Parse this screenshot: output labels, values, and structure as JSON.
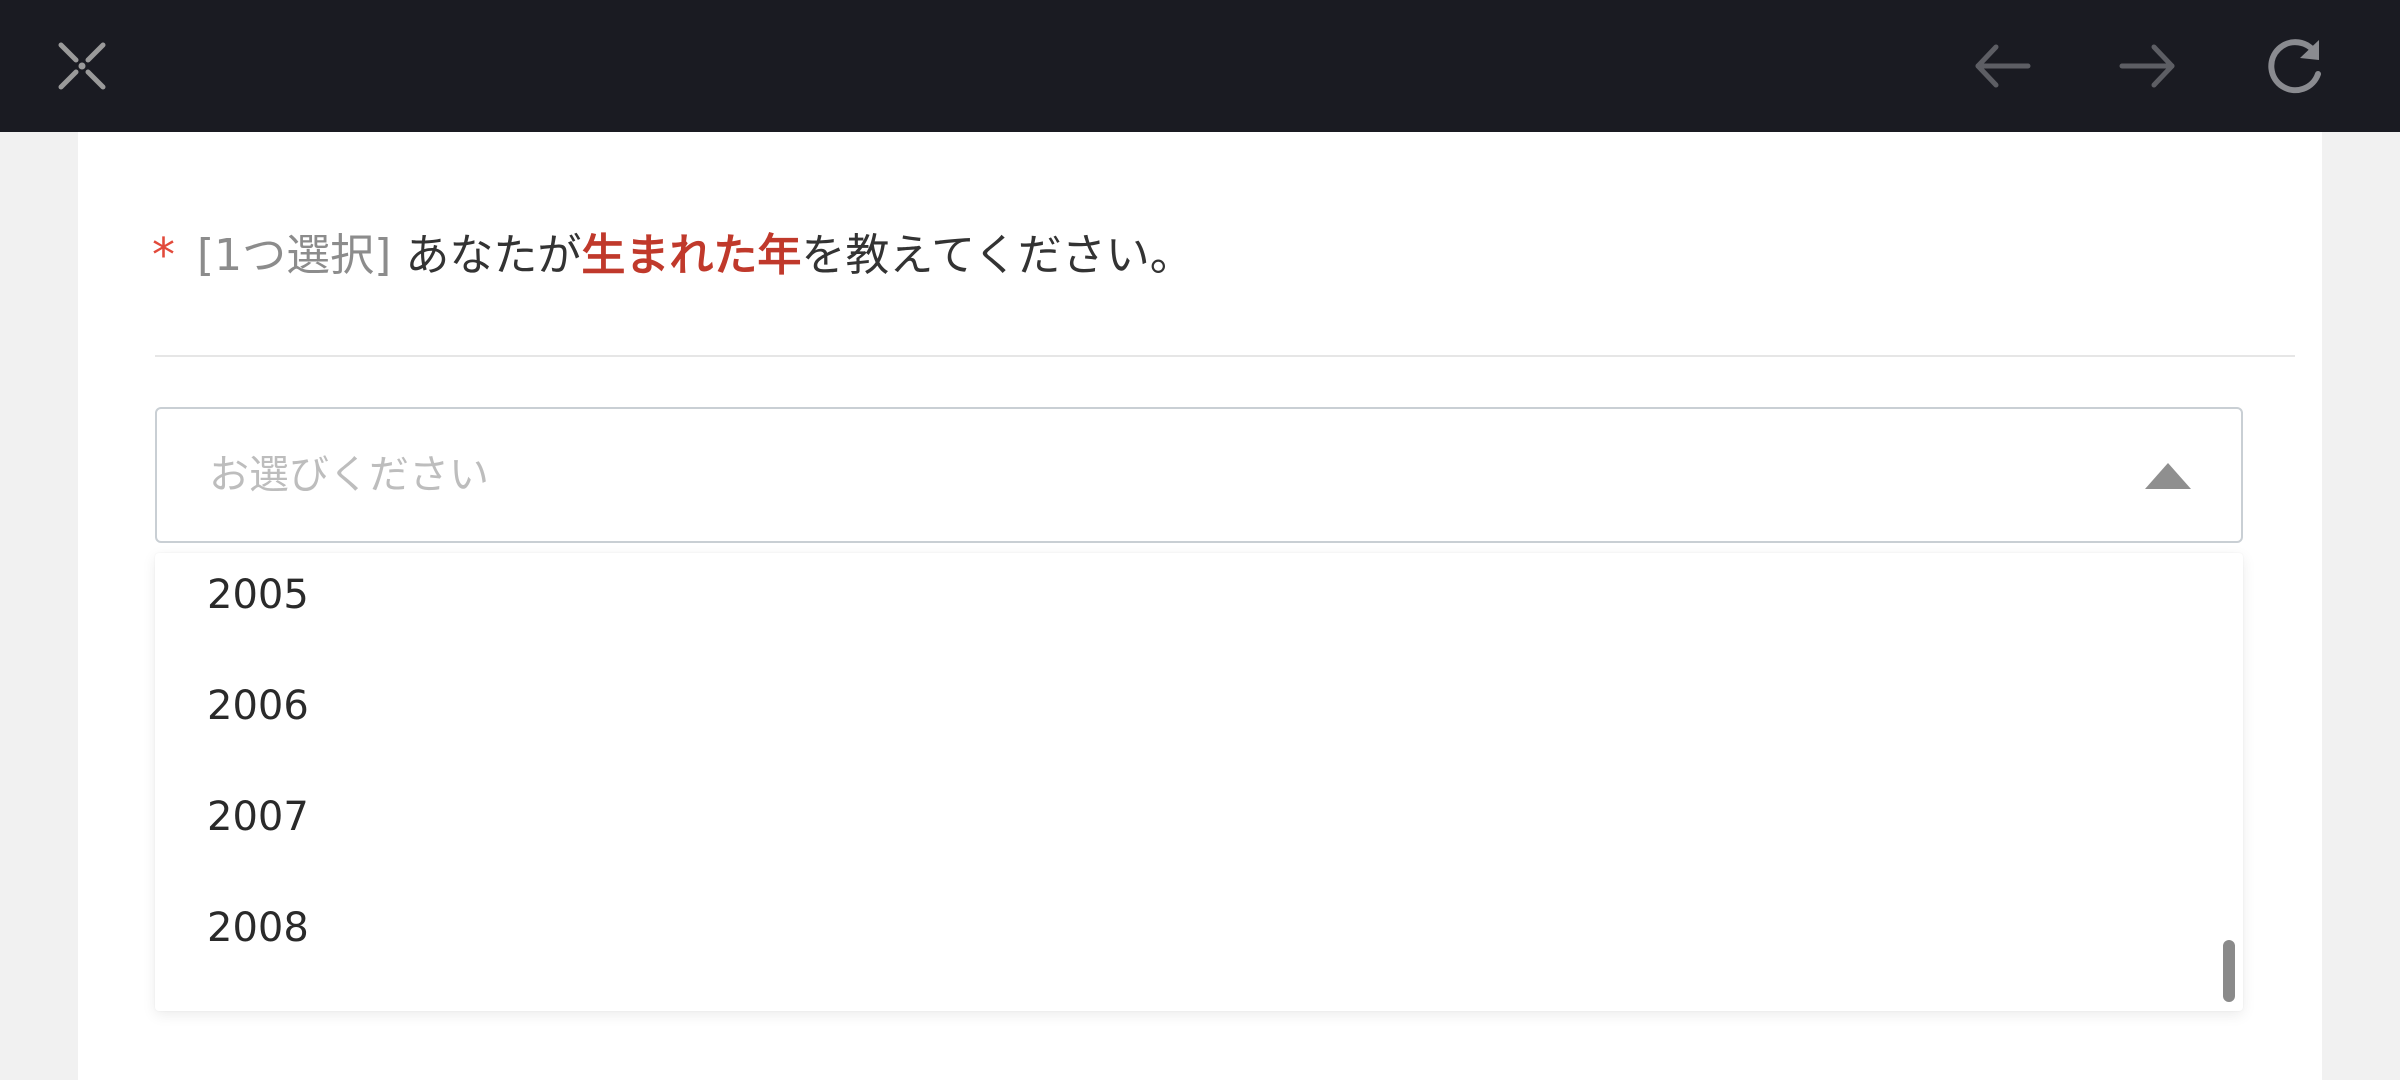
{
  "toolbar": {
    "close_icon": "close-x-icon",
    "back_icon": "arrow-left-icon",
    "forward_icon": "arrow-right-icon",
    "reload_icon": "reload-icon",
    "background": "#1a1b22"
  },
  "question": {
    "required_mark": "*",
    "tag": "[1つ選択]",
    "text_before": "あなたが",
    "highlight": "生まれた年",
    "text_after": "を教えてください。",
    "highlight_color": "#c0392b"
  },
  "select": {
    "placeholder": "お選びください",
    "expanded": true,
    "options_visible": [
      "2005",
      "2006",
      "2007",
      "2008"
    ]
  }
}
